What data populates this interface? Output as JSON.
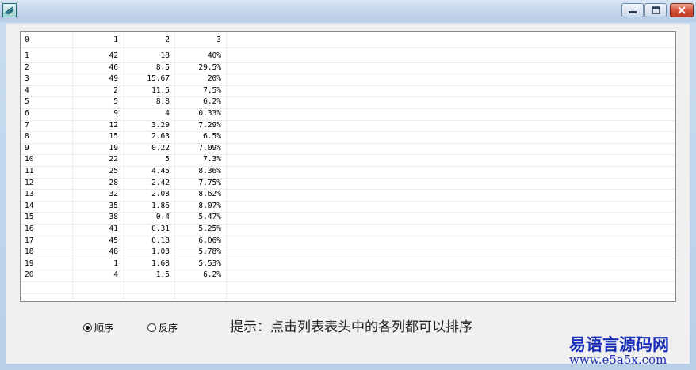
{
  "window": {
    "controls": {
      "minimize_icon": "minimize-icon",
      "maximize_icon": "maximize-icon",
      "close_icon": "close-icon"
    }
  },
  "list": {
    "columns": [
      "0",
      "1",
      "2",
      "3"
    ],
    "rows": [
      [
        "1",
        "42",
        "18",
        "40%"
      ],
      [
        "2",
        "46",
        "8.5",
        "29.5%"
      ],
      [
        "3",
        "49",
        "15.67",
        "20%"
      ],
      [
        "4",
        "2",
        "11.5",
        "7.5%"
      ],
      [
        "5",
        "5",
        "8.8",
        "6.2%"
      ],
      [
        "6",
        "9",
        "4",
        "0.33%"
      ],
      [
        "7",
        "12",
        "3.29",
        "7.29%"
      ],
      [
        "8",
        "15",
        "2.63",
        "6.5%"
      ],
      [
        "9",
        "19",
        "0.22",
        "7.09%"
      ],
      [
        "10",
        "22",
        "5",
        "7.3%"
      ],
      [
        "11",
        "25",
        "4.45",
        "8.36%"
      ],
      [
        "12",
        "28",
        "2.42",
        "7.75%"
      ],
      [
        "13",
        "32",
        "2.08",
        "8.62%"
      ],
      [
        "14",
        "35",
        "1.86",
        "8.07%"
      ],
      [
        "15",
        "38",
        "0.4",
        "5.47%"
      ],
      [
        "16",
        "41",
        "0.31",
        "5.25%"
      ],
      [
        "17",
        "45",
        "0.18",
        "6.06%"
      ],
      [
        "18",
        "48",
        "1.03",
        "5.78%"
      ],
      [
        "19",
        "1",
        "1.68",
        "5.53%"
      ],
      [
        "20",
        "4",
        "1.5",
        "6.2%"
      ]
    ]
  },
  "sort": {
    "ascending_label": "顺序",
    "descending_label": "反序",
    "selected": "ascending"
  },
  "hint": "提示：点击列表表头中的各列都可以排序",
  "watermark": {
    "name": "易语言源码网",
    "url": "www.e5a5x.com"
  }
}
